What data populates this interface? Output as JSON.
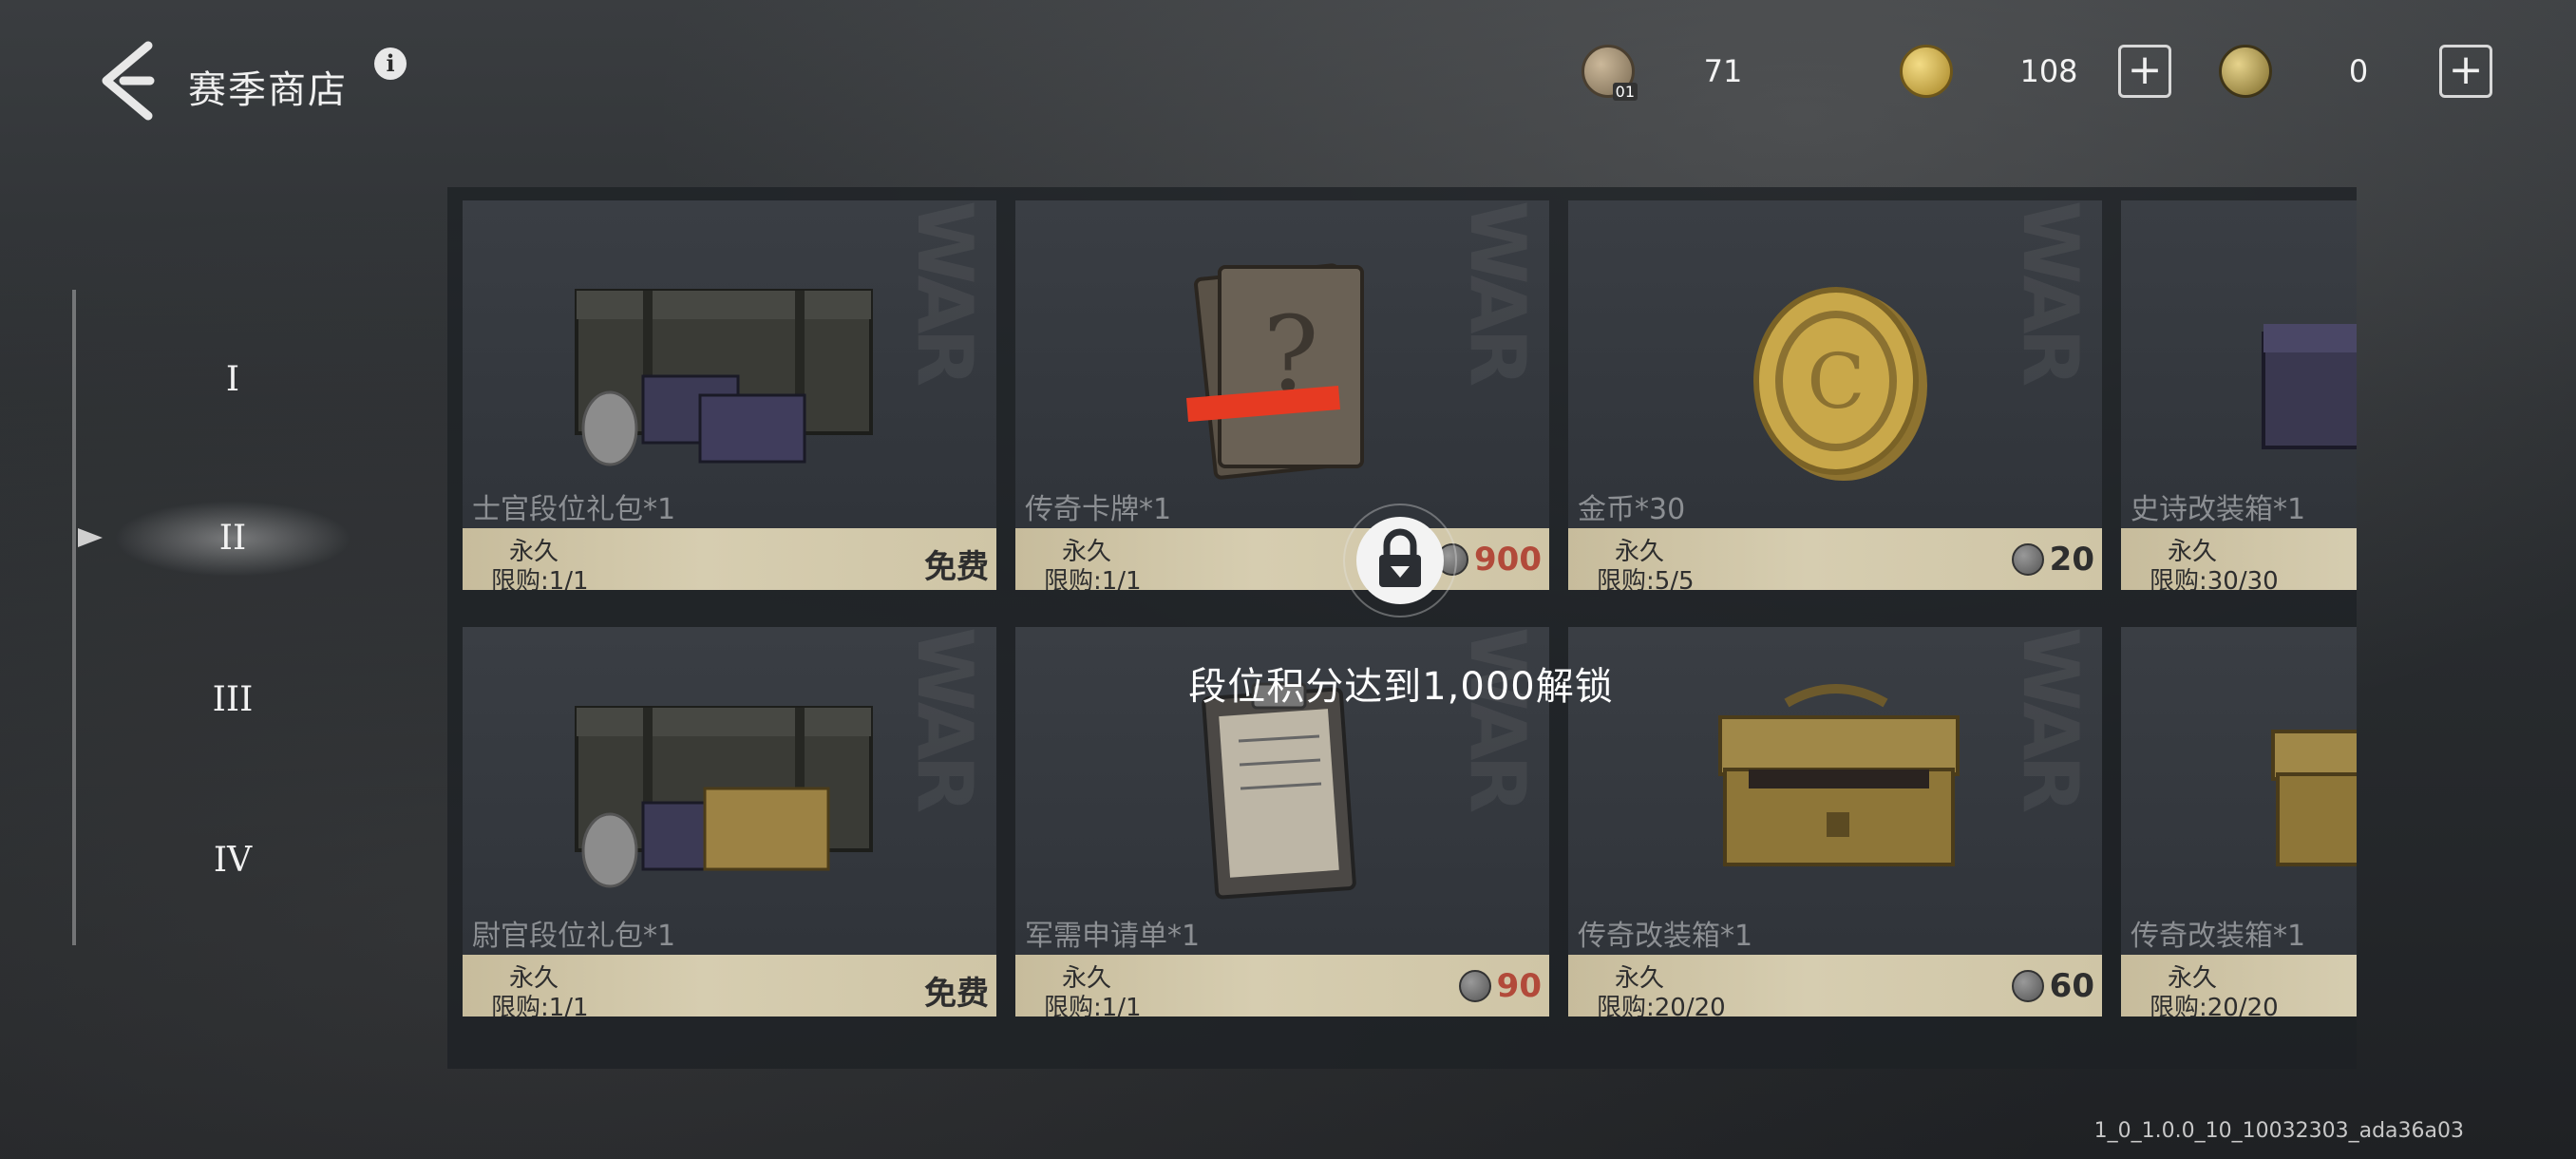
{
  "header": {
    "title": "赛季商店",
    "info_label": "i",
    "currencies": [
      {
        "name": "season-token",
        "icon": "season-token-icon",
        "badge": "01",
        "value": "71",
        "has_plus": false
      },
      {
        "name": "gold",
        "icon": "gold-coin-icon",
        "value": "108",
        "has_plus": true
      },
      {
        "name": "premium",
        "icon": "premium-coin-icon",
        "value": "0",
        "has_plus": true
      }
    ],
    "plus_label": "+"
  },
  "tiers": [
    {
      "label": "I",
      "active": false
    },
    {
      "label": "II",
      "active": true
    },
    {
      "label": "III",
      "active": false
    },
    {
      "label": "IV",
      "active": false
    }
  ],
  "shop": {
    "items": [
      {
        "name": "士官段位礼包*1",
        "duration": "永久",
        "limit": "限购:1/1",
        "price": "免费",
        "price_type": "free",
        "image": "military-crate"
      },
      {
        "name": "传奇卡牌*1",
        "duration": "永久",
        "limit": "限购:1/1",
        "price": "900",
        "price_type": "red",
        "image": "mystery-card"
      },
      {
        "name": "金币*30",
        "duration": "永久",
        "limit": "限购:5/5",
        "price": "20",
        "price_type": "coin",
        "image": "gold-coin"
      },
      {
        "name": "史诗改装箱*1",
        "duration": "永久",
        "limit": "限购:30/30",
        "price": "",
        "price_type": "coin",
        "image": "purple-case"
      },
      {
        "name": "尉官段位礼包*1",
        "duration": "永久",
        "limit": "限购:1/1",
        "price": "免费",
        "price_type": "free",
        "image": "military-crate-gold"
      },
      {
        "name": "军需申请单*1",
        "duration": "永久",
        "limit": "限购:1/1",
        "price": "90",
        "price_type": "red",
        "image": "clipboard"
      },
      {
        "name": "传奇改装箱*1",
        "duration": "永久",
        "limit": "限购:20/20",
        "price": "60",
        "price_type": "coin",
        "image": "toolbox"
      },
      {
        "name": "传奇改装箱*1",
        "duration": "永久",
        "limit": "限购:20/20",
        "price": "",
        "price_type": "coin",
        "image": "toolbox"
      }
    ],
    "watermark": "WAR"
  },
  "lock": {
    "message": "段位积分达到1,000解锁",
    "icon": "lock-icon"
  },
  "build_version": "1_0_1.0.0_10_10032303_ada36a03",
  "colors": {
    "accent_red": "#e63a22",
    "price_bar": "#d2c8aa",
    "gold": "#c9a84a"
  }
}
